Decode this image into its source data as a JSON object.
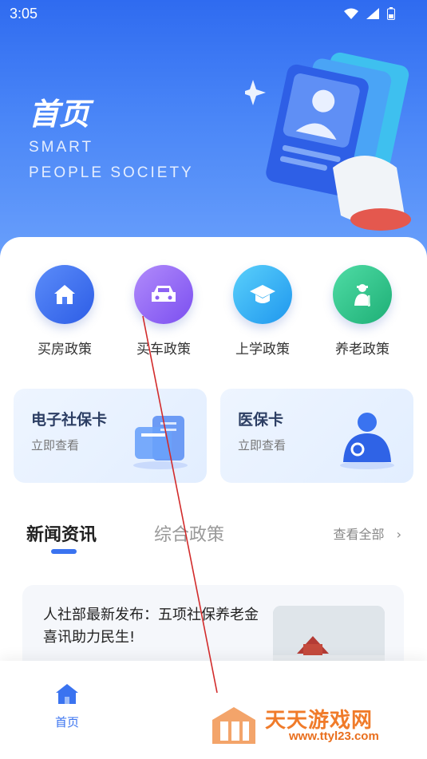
{
  "status_bar": {
    "time": "3:05"
  },
  "hero": {
    "title": "首页",
    "subtitle_line1": "SMART",
    "subtitle_line2": "PEOPLE SOCIETY"
  },
  "quick_actions": [
    {
      "label": "买房政策",
      "icon": "house-icon",
      "color": "#3f72f5"
    },
    {
      "label": "买车政策",
      "icon": "car-icon",
      "color": "#8a5cf6"
    },
    {
      "label": "上学政策",
      "icon": "graduation-cap-icon",
      "color": "#2aa7f2"
    },
    {
      "label": "养老政策",
      "icon": "elderly-person-icon",
      "color": "#2fc38d"
    }
  ],
  "cards": [
    {
      "title": "电子社保卡",
      "subtitle": "立即查看"
    },
    {
      "title": "医保卡",
      "subtitle": "立即查看"
    }
  ],
  "tabs": {
    "news": "新闻资讯",
    "policy": "综合政策",
    "view_all": "查看全部"
  },
  "news_item": {
    "title": "人社部最新发布：五项社保养老金喜讯助力民生!"
  },
  "bottom_nav": {
    "home_label": "首页"
  },
  "watermark": {
    "title": "天天游戏网",
    "url": "www.ttyl23.com"
  },
  "colors": {
    "accent": "#3a73f0",
    "hero_top": "#2f6bf0"
  }
}
